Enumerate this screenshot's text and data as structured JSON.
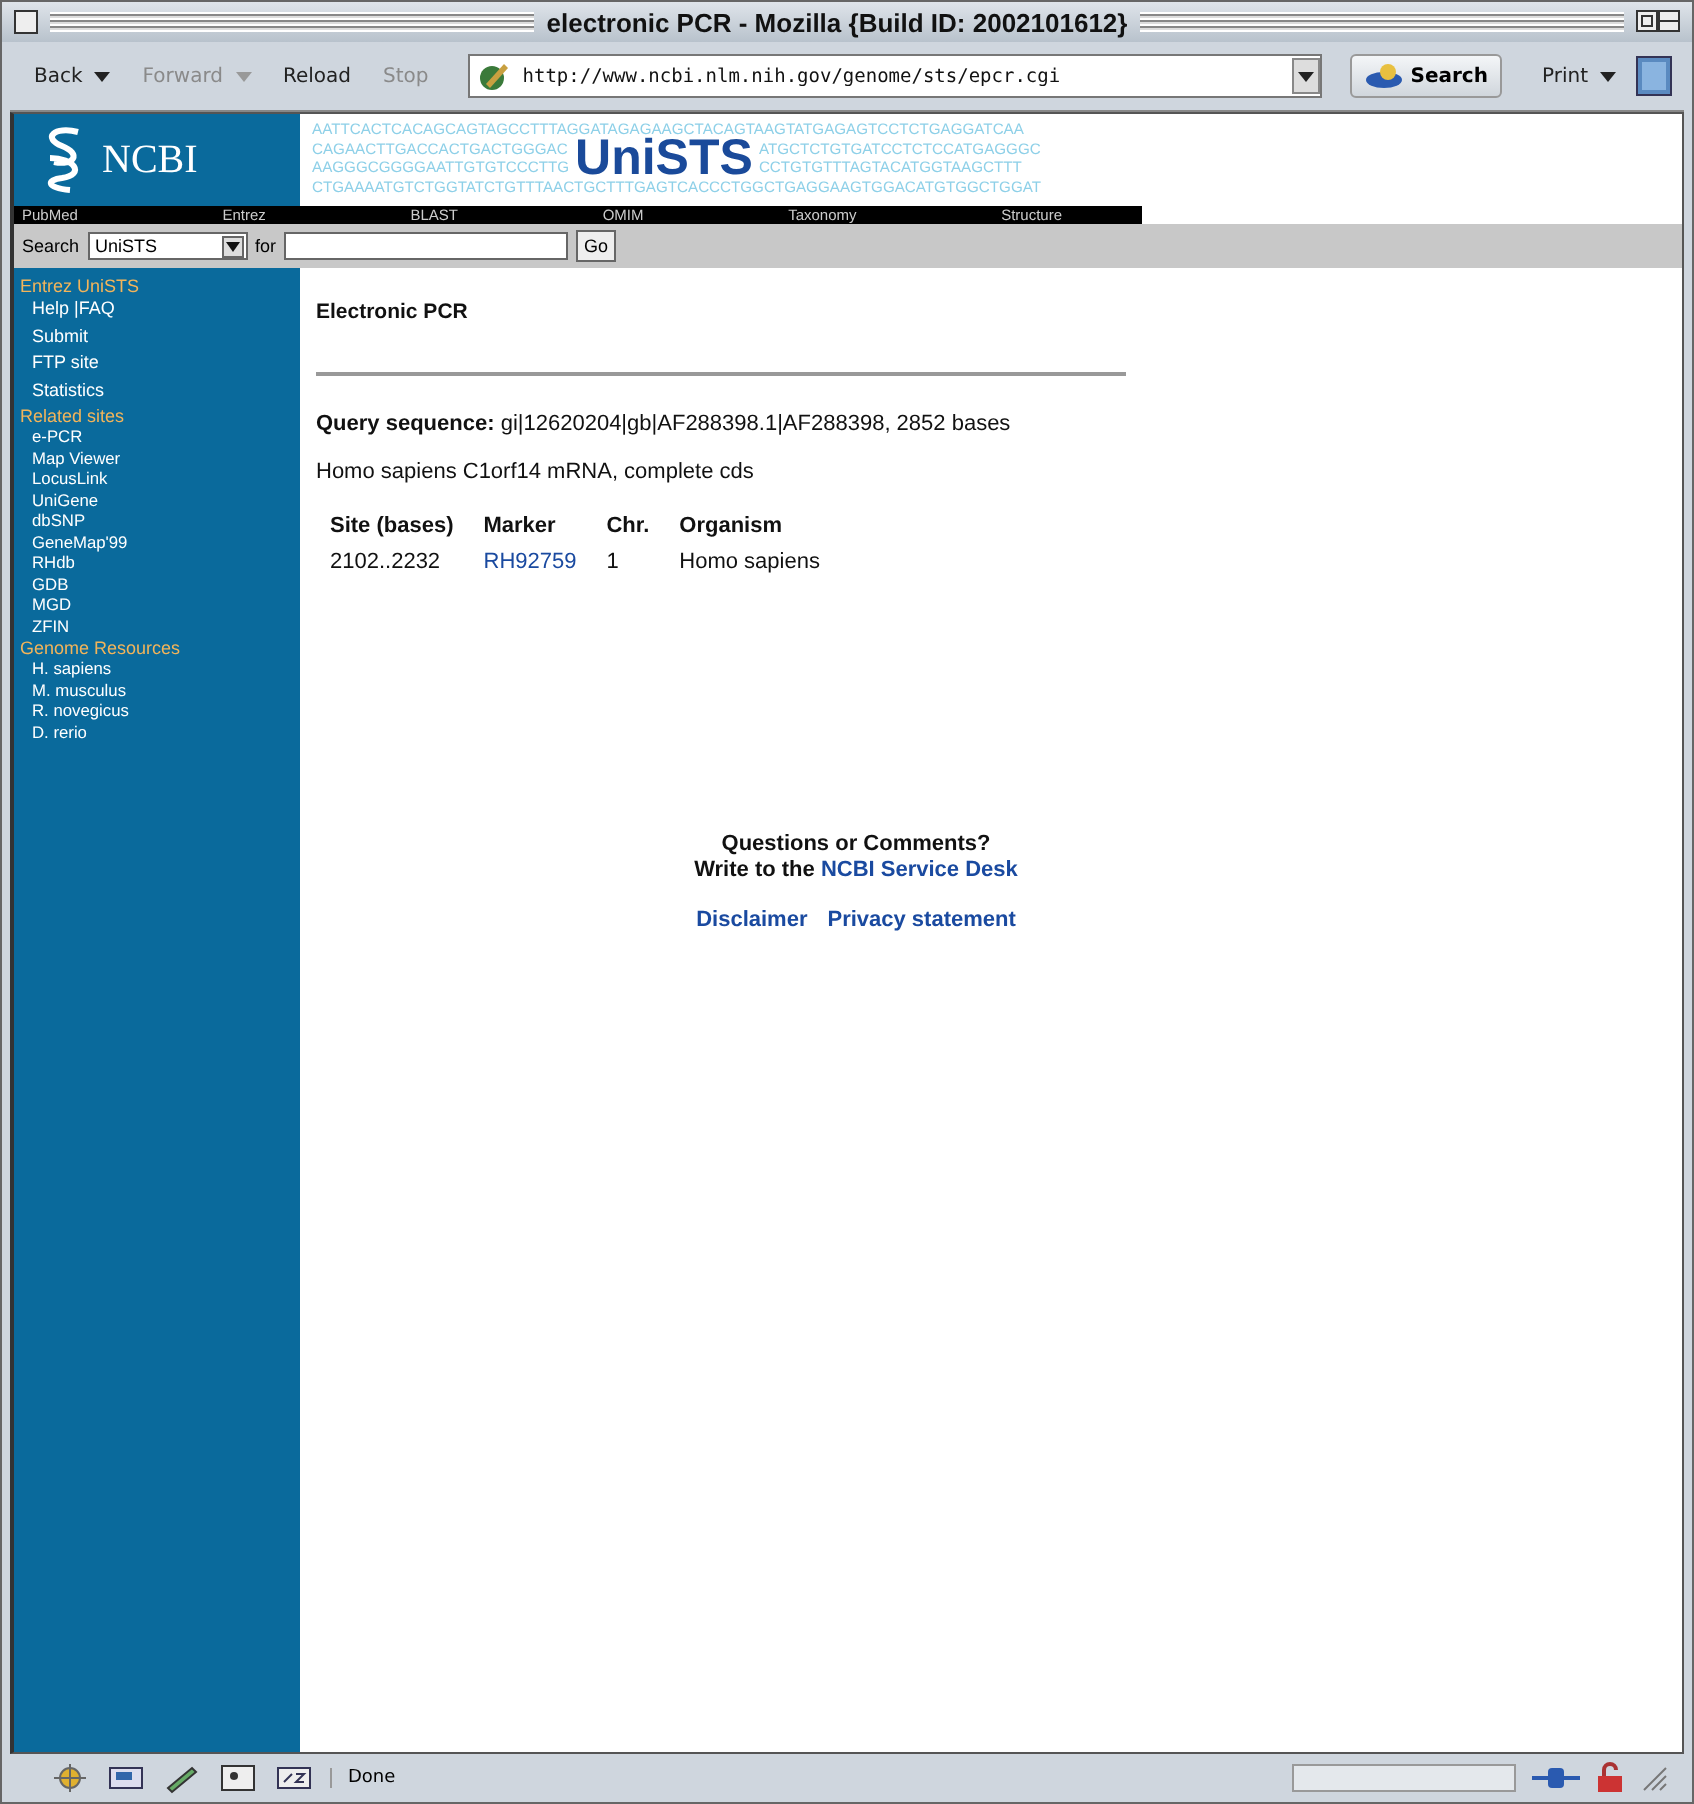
{
  "window": {
    "title": "electronic PCR - Mozilla {Build ID: 2002101612}"
  },
  "toolbar": {
    "buttons": [
      {
        "label": "Back",
        "disabled": false,
        "menu": true
      },
      {
        "label": "Forward",
        "disabled": true,
        "menu": true
      },
      {
        "label": "Reload",
        "disabled": false,
        "menu": false
      },
      {
        "label": "Stop",
        "disabled": true,
        "menu": false
      }
    ],
    "url": "http://www.ncbi.nlm.nih.gov/genome/sts/epcr.cgi",
    "search_button": "Search",
    "print_button": "Print"
  },
  "banner": {
    "logo": "NCBI",
    "title": "UniSTS",
    "sequence_top": "AATTCACTCACAGCAGTAGCCTTTAGGATAGAGAAGCTACAGTAAGTATGAGAGTCCTCTGAGGATCAA",
    "sequence_middle": [
      {
        "left": "CAGAACTTGACCACTGACTGGGAC",
        "right": "ATGCTCTGTGATCCTCTCCATGAGGGC"
      },
      {
        "left": "AAGGGCGGGGAATTGTGTCCCTTG",
        "right": "CCTGTGTTTAGTACATGGTAAGCTTT"
      }
    ],
    "sequence_bottom": "CTGAAAATGTCTGGTATCTGTTTAACTGCTTTGAGTCACCCTGGCTGAGGAAGTGGACATGTGGCTGGAT"
  },
  "nav": [
    "PubMed",
    "Entrez",
    "BLAST",
    "OMIM",
    "Taxonomy",
    "Structure"
  ],
  "searchbar": {
    "label": "Search",
    "database": "UniSTS",
    "for_label": "for",
    "go": "Go"
  },
  "sidebar": [
    {
      "heading": "Entrez UniSTS",
      "items": [
        "Help |FAQ",
        "Submit",
        "FTP site",
        "Statistics"
      ]
    },
    {
      "heading": "Related sites",
      "items": [
        "e-PCR",
        "Map Viewer",
        "LocusLink",
        "UniGene",
        "dbSNP",
        "GeneMap'99",
        "RHdb",
        "GDB",
        "MGD",
        "ZFIN"
      ]
    },
    {
      "heading": "Genome Resources",
      "items": [
        "H. sapiens",
        "M. musculus",
        "R. novegicus",
        "D. rerio"
      ]
    }
  ],
  "content": {
    "heading": "Electronic PCR",
    "query": "**Query sequence:** gi|12620204|gb|AF288398.1|AF288398, 2852 bases",
    "description": "Homo sapiens C1orf14 mRNA, complete cds",
    "table": {
      "columns": [
        "Site (bases)",
        "Marker",
        "Chr.",
        "Organism"
      ],
      "rows": [
        [
          "2102..2232",
          "RH92759",
          "1",
          "Homo sapiens"
        ]
      ]
    }
  },
  "footer": {
    "question": "Questions or Comments?",
    "write_to": "Write to the",
    "service_desk": "NCBI Service Desk",
    "links": [
      "Disclaimer",
      "Privacy statement"
    ]
  },
  "status_bar": {
    "text": "Done",
    "level": 0
  }
}
